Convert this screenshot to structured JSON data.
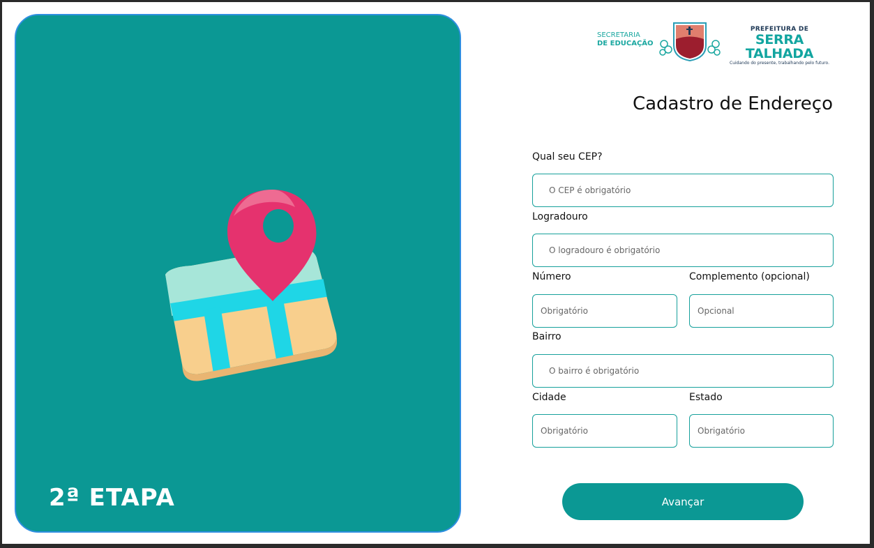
{
  "hero": {
    "step_label": "2ª ETAPA"
  },
  "header": {
    "secretaria_line1": "SECRETARIA",
    "secretaria_line2": "DE EDUCAÇÃO",
    "prefeitura_top": "PREFEITURA DE",
    "prefeitura_name": "SERRA TALHADA",
    "prefeitura_slogan": "Cuidando do presente, trabalhando pelo futuro."
  },
  "form": {
    "title": "Cadastro de Endereço",
    "cep": {
      "label": "Qual seu CEP?",
      "placeholder": "O CEP é obrigatório",
      "value": ""
    },
    "logradouro": {
      "label": "Logradouro",
      "placeholder": "O logradouro é obrigatório",
      "value": ""
    },
    "numero": {
      "label": "Número",
      "placeholder": "Obrigatório",
      "value": ""
    },
    "complemento": {
      "label": "Complemento (opcional)",
      "placeholder": "Opcional",
      "value": ""
    },
    "bairro": {
      "label": "Bairro",
      "placeholder": "O bairro é obrigatório",
      "value": ""
    },
    "cidade": {
      "label": "Cidade",
      "placeholder": "Obrigatório",
      "value": ""
    },
    "estado": {
      "label": "Estado",
      "placeholder": "Obrigatório",
      "value": ""
    },
    "submit_label": "Avançar"
  },
  "colors": {
    "primary": "#0b9894",
    "hero_border": "#2f8fe0",
    "field_border": "#16a09b",
    "pin": "#e5326e"
  },
  "icons": {
    "illustration": "map-pin-icon"
  }
}
